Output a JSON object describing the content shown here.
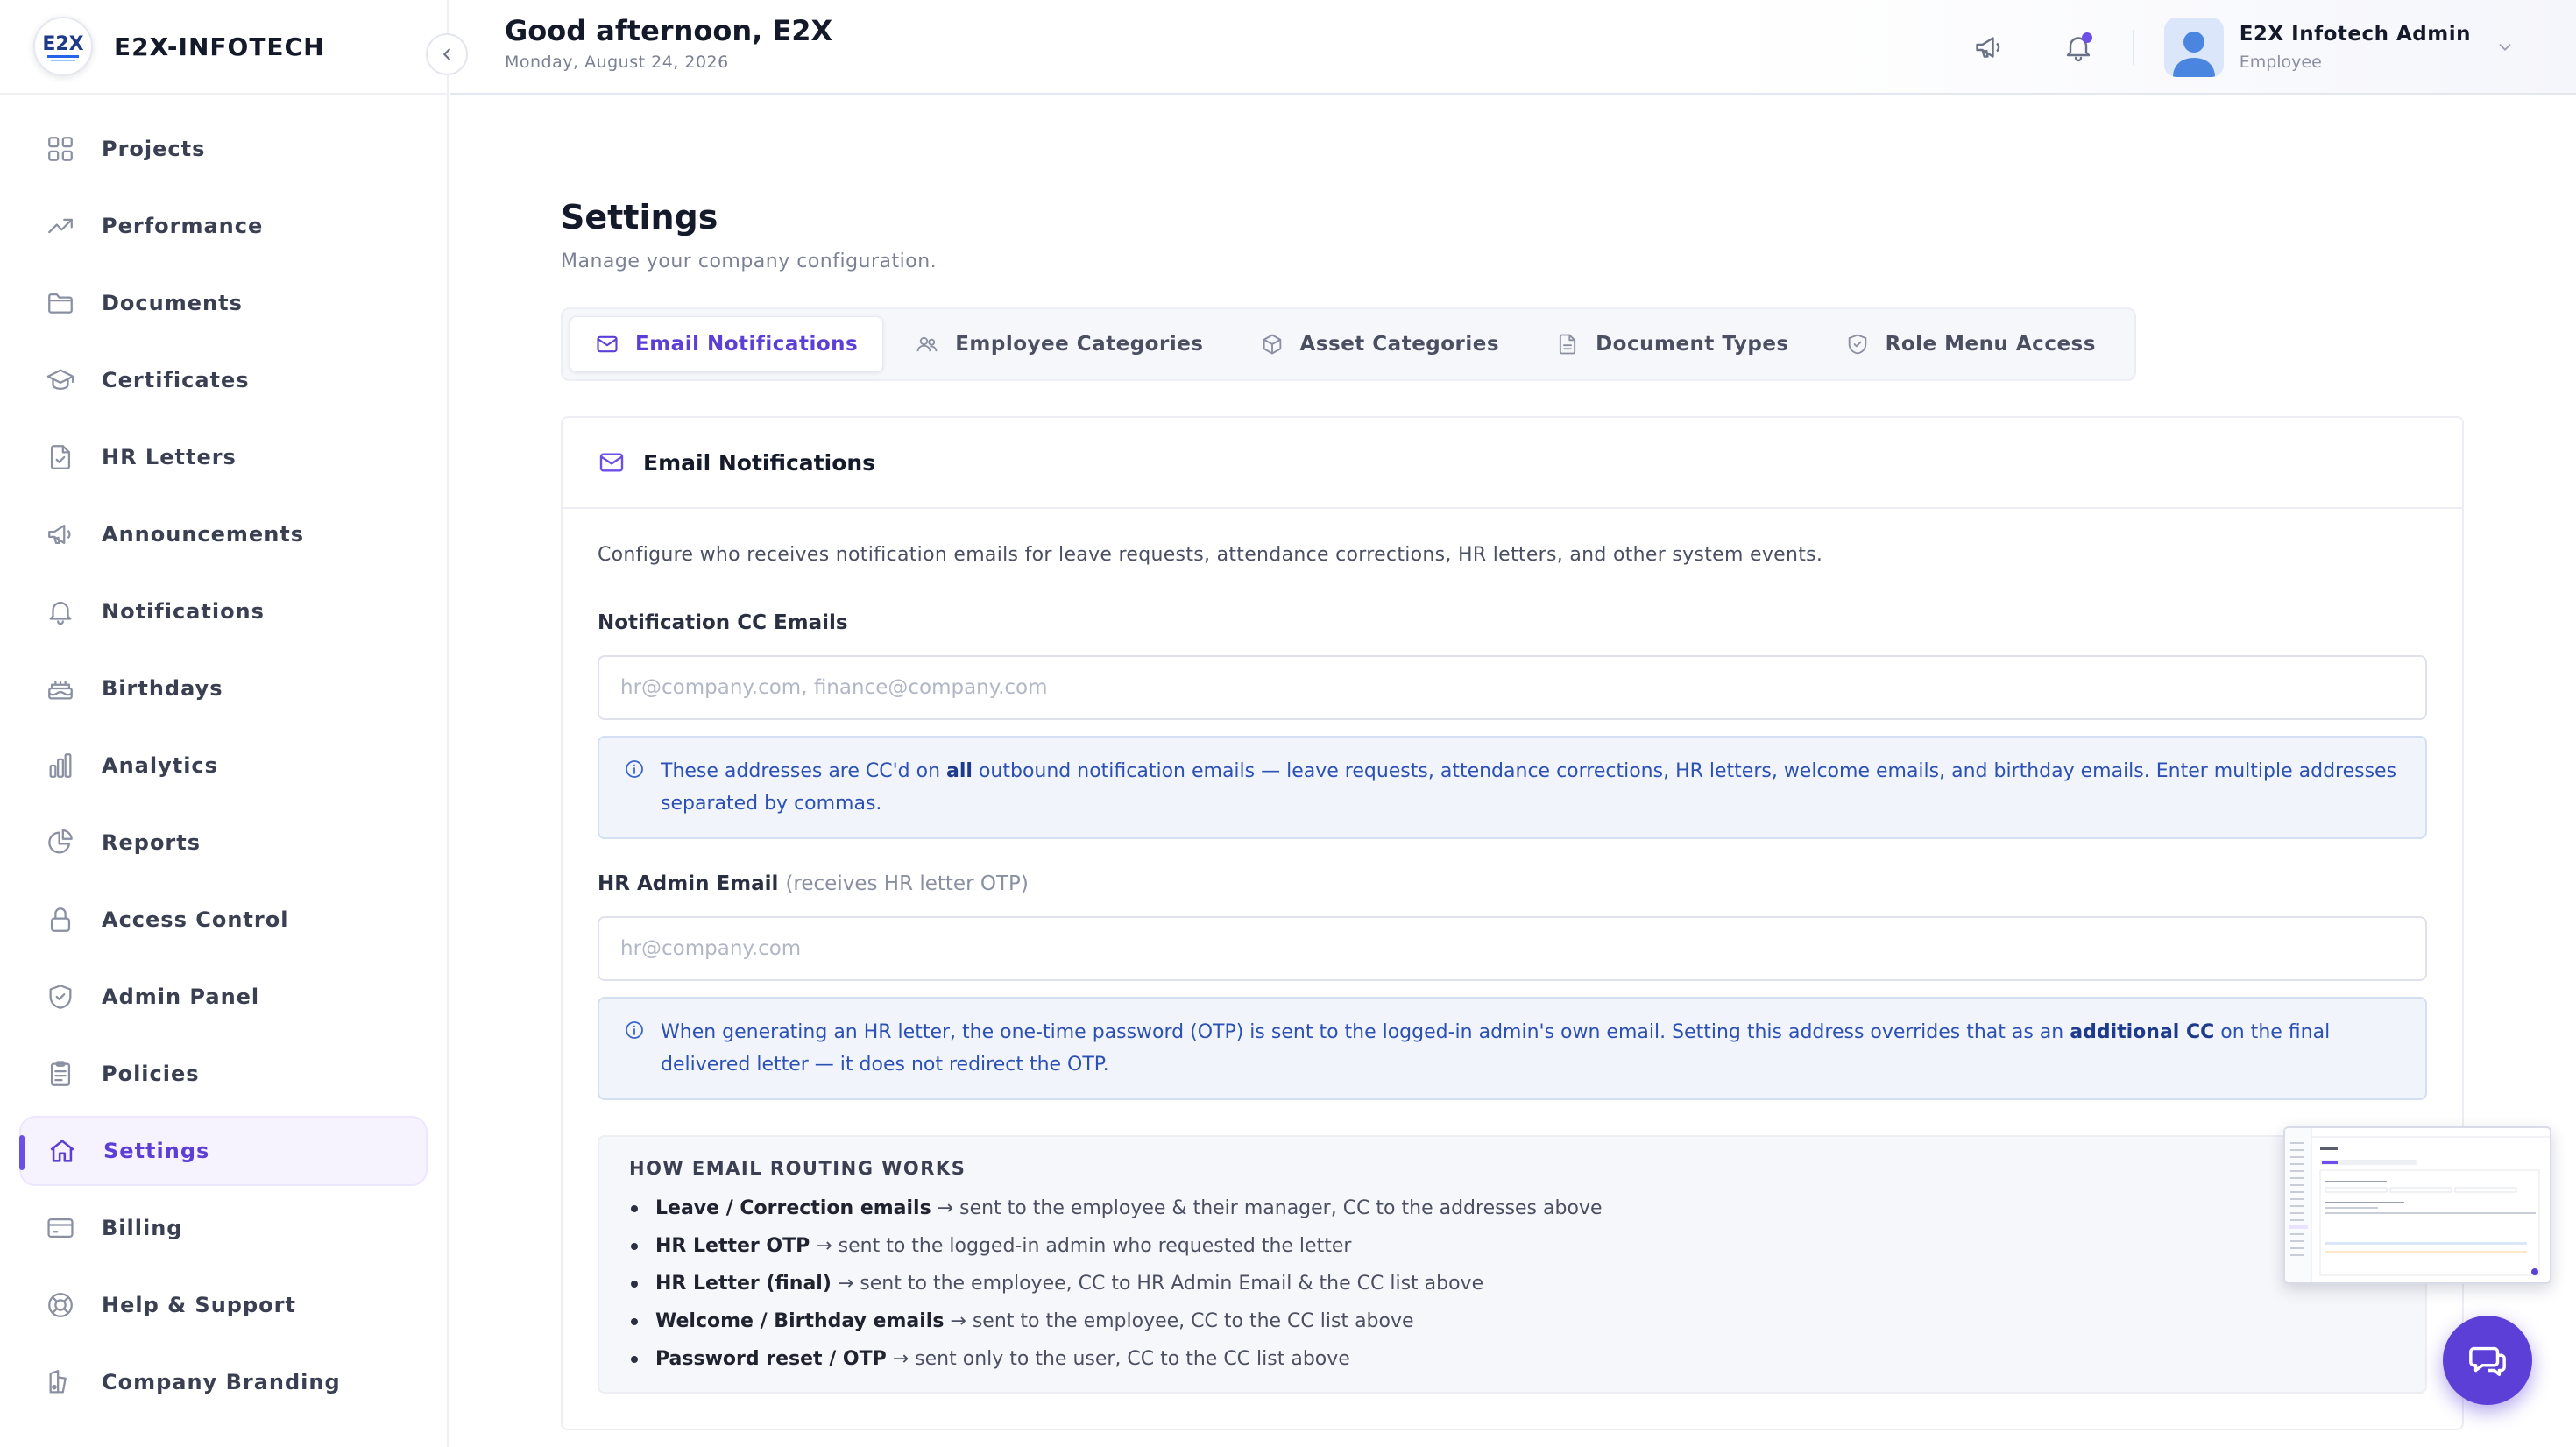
{
  "brand": {
    "name": "E2X-INFOTECH",
    "logo_text": "E2X"
  },
  "sidebar": {
    "items": [
      {
        "label": "Projects",
        "icon": "grid-icon"
      },
      {
        "label": "Performance",
        "icon": "trending-up-icon"
      },
      {
        "label": "Documents",
        "icon": "folder-icon"
      },
      {
        "label": "Certificates",
        "icon": "graduation-cap-icon"
      },
      {
        "label": "HR Letters",
        "icon": "file-check-icon"
      },
      {
        "label": "Announcements",
        "icon": "megaphone-icon"
      },
      {
        "label": "Notifications",
        "icon": "bell-icon"
      },
      {
        "label": "Birthdays",
        "icon": "cake-icon"
      },
      {
        "label": "Analytics",
        "icon": "bar-chart-icon"
      },
      {
        "label": "Reports",
        "icon": "pie-chart-icon"
      },
      {
        "label": "Access Control",
        "icon": "lock-icon"
      },
      {
        "label": "Admin Panel",
        "icon": "shield-icon"
      },
      {
        "label": "Policies",
        "icon": "clipboard-icon"
      },
      {
        "label": "Settings",
        "icon": "home-icon",
        "active": true
      },
      {
        "label": "Billing",
        "icon": "credit-card-icon"
      },
      {
        "label": "Help & Support",
        "icon": "lifebuoy-icon"
      },
      {
        "label": "Company Branding",
        "icon": "palette-icon"
      }
    ]
  },
  "header": {
    "greeting": "Good afternoon, E2X",
    "date": "Monday, August 24, 2026",
    "user_name": "E2X Infotech Admin",
    "user_role": "Employee"
  },
  "page": {
    "title": "Settings",
    "subtitle": "Manage your company configuration."
  },
  "tabs": [
    {
      "label": "Email Notifications",
      "icon": "mail-icon",
      "active": true
    },
    {
      "label": "Employee Categories",
      "icon": "users-icon"
    },
    {
      "label": "Asset Categories",
      "icon": "box-icon"
    },
    {
      "label": "Document Types",
      "icon": "file-icon"
    },
    {
      "label": "Role Menu Access",
      "icon": "shield-check-icon"
    }
  ],
  "card": {
    "title": "Email Notifications",
    "description": "Configure who receives notification emails for leave requests, attendance corrections, HR letters, and other system events.",
    "cc_field": {
      "label": "Notification CC Emails",
      "placeholder": "hr@company.com, finance@company.com",
      "value": "",
      "info_pre": "These addresses are CC'd on ",
      "info_bold": "all",
      "info_post": " outbound notification emails — leave requests, attendance corrections, HR letters, welcome emails, and birthday emails. Enter multiple addresses separated by commas."
    },
    "hr_field": {
      "label": "HR Admin Email",
      "hint": "(receives HR letter OTP)",
      "placeholder": "hr@company.com",
      "value": "",
      "info_pre": "When generating an HR letter, the one-time password (OTP) is sent to the logged-in admin's own email. Setting this address overrides that as an ",
      "info_bold": "additional CC",
      "info_post": " on the final delivered letter — it does not redirect the OTP."
    },
    "routing": {
      "title": "HOW EMAIL ROUTING WORKS",
      "rules": [
        {
          "key": "Leave / Correction emails",
          "text": " → sent to the employee & their manager, CC to the addresses above"
        },
        {
          "key": "HR Letter OTP",
          "text": " → sent to the logged-in admin who requested the letter"
        },
        {
          "key": "HR Letter (final)",
          "text": " → sent to the employee, CC to HR Admin Email & the CC list above"
        },
        {
          "key": "Welcome / Birthday emails",
          "text": " → sent to the employee, CC to the CC list above"
        },
        {
          "key": "Password reset / OTP",
          "text": " → sent only to the user, CC to the CC list above"
        }
      ]
    }
  },
  "colors": {
    "accent": "#5b3fd6",
    "info_bg": "#f1f5fb",
    "info_text": "#2c50b4"
  }
}
